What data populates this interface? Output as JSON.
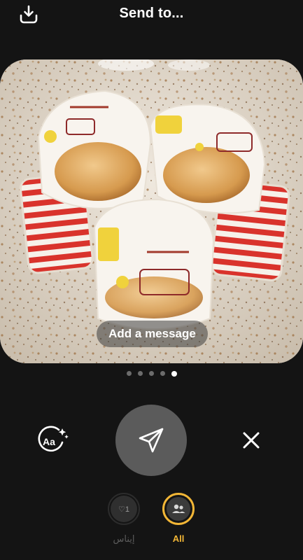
{
  "header": {
    "title": "Send to...",
    "download_icon": "download-icon"
  },
  "photo": {
    "description_icon": "photo-preview",
    "message_placeholder": "Add a message"
  },
  "pager": {
    "count": 5,
    "active_index": 4
  },
  "controls": {
    "text_icon": "text-style-icon",
    "text_icon_label": "Aa",
    "send_icon": "paper-plane-icon",
    "close_icon": "close-icon"
  },
  "recipients": [
    {
      "label": "إيناس",
      "badge": "♡1",
      "selected": false
    },
    {
      "label": "All",
      "icon": "group-icon",
      "selected": true
    }
  ],
  "colors": {
    "background": "#141414",
    "accent": "#f2b636",
    "send_button": "#5b5b5b"
  }
}
